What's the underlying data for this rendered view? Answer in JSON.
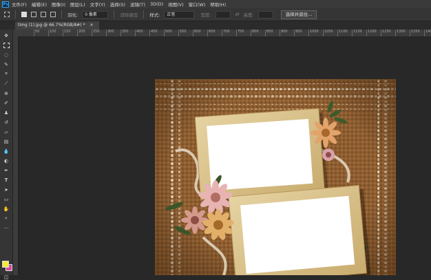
{
  "app": {
    "logo": "Ps"
  },
  "menu": [
    "文件(F)",
    "编辑(E)",
    "图像(I)",
    "图层(L)",
    "文字(Y)",
    "选择(S)",
    "滤镜(T)",
    "3D(D)",
    "视图(V)",
    "窗口(W)",
    "帮助(H)"
  ],
  "options": {
    "feather_label": "羽化:",
    "feather_value": "0 像素",
    "antialias_label": "消除锯齿",
    "style_label": "样式:",
    "style_value": "正常",
    "width_label": "宽度:",
    "height_label": "高度:",
    "select_mask_button": "选择并遮住..."
  },
  "document": {
    "tab_title": "timg (1).jpg @ 66.7%(RGB/8#) *",
    "tab_close": "×"
  },
  "ruler": {
    "ticks": [
      "50",
      "100",
      "150",
      "200",
      "250",
      "300",
      "350",
      "400",
      "450",
      "500",
      "550",
      "600",
      "650",
      "700",
      "750",
      "800",
      "850",
      "900",
      "950",
      "1000",
      "1050",
      "1100",
      "1150",
      "1200",
      "1250",
      "1300",
      "1350",
      "1400"
    ]
  },
  "tools": [
    "move-icon",
    "marquee-icon",
    "lasso-icon",
    "quick-select-icon",
    "crop-icon",
    "eyedropper-icon",
    "healing-icon",
    "brush-icon",
    "stamp-icon",
    "history-brush-icon",
    "eraser-icon",
    "gradient-icon",
    "blur-icon",
    "dodge-icon",
    "pen-icon",
    "type-icon",
    "path-select-icon",
    "shape-icon",
    "hand-icon",
    "zoom-icon",
    "more-icon"
  ],
  "colors": {
    "foreground": "#f4ec3a",
    "background": "#d64ca0",
    "burlap": "#8a5a2e",
    "frame": "#d9c38f"
  }
}
